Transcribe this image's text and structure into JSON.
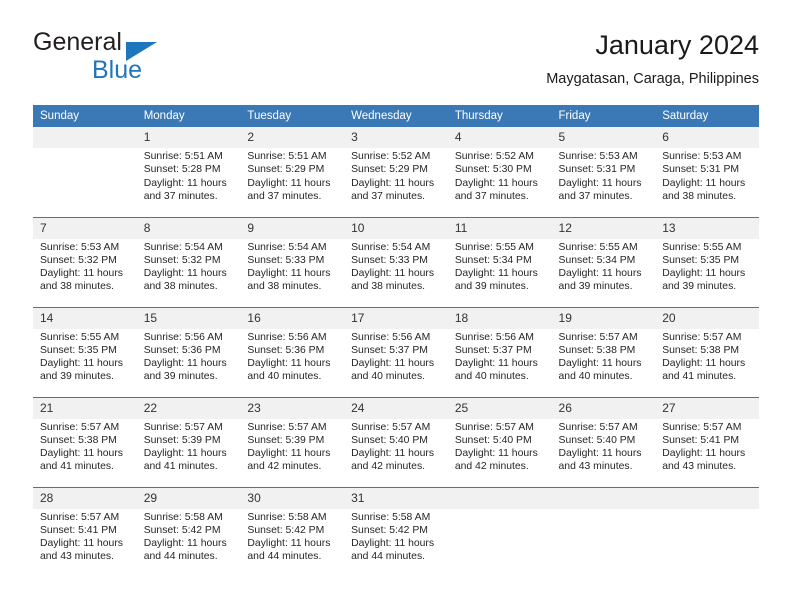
{
  "brand": {
    "word_one": "General",
    "word_two": "Blue",
    "triangle_color": "#1f76bc"
  },
  "header": {
    "title": "January 2024",
    "subtitle": "Maygatasan, Caraga, Philippines"
  },
  "theme": {
    "header_blue": "#3b78b6",
    "daynum_band": "#f1f1f1",
    "text": "#262626"
  },
  "weekday_headers": [
    "Sunday",
    "Monday",
    "Tuesday",
    "Wednesday",
    "Thursday",
    "Friday",
    "Saturday"
  ],
  "weeks": [
    [
      {
        "day": "",
        "empty": true,
        "sunrise": "",
        "sunset": "",
        "daylight": ""
      },
      {
        "day": "1",
        "sunrise": "Sunrise: 5:51 AM",
        "sunset": "Sunset: 5:28 PM",
        "daylight": "Daylight: 11 hours and 37 minutes."
      },
      {
        "day": "2",
        "sunrise": "Sunrise: 5:51 AM",
        "sunset": "Sunset: 5:29 PM",
        "daylight": "Daylight: 11 hours and 37 minutes."
      },
      {
        "day": "3",
        "sunrise": "Sunrise: 5:52 AM",
        "sunset": "Sunset: 5:29 PM",
        "daylight": "Daylight: 11 hours and 37 minutes."
      },
      {
        "day": "4",
        "sunrise": "Sunrise: 5:52 AM",
        "sunset": "Sunset: 5:30 PM",
        "daylight": "Daylight: 11 hours and 37 minutes."
      },
      {
        "day": "5",
        "sunrise": "Sunrise: 5:53 AM",
        "sunset": "Sunset: 5:31 PM",
        "daylight": "Daylight: 11 hours and 37 minutes."
      },
      {
        "day": "6",
        "sunrise": "Sunrise: 5:53 AM",
        "sunset": "Sunset: 5:31 PM",
        "daylight": "Daylight: 11 hours and 38 minutes."
      }
    ],
    [
      {
        "day": "7",
        "sunrise": "Sunrise: 5:53 AM",
        "sunset": "Sunset: 5:32 PM",
        "daylight": "Daylight: 11 hours and 38 minutes."
      },
      {
        "day": "8",
        "sunrise": "Sunrise: 5:54 AM",
        "sunset": "Sunset: 5:32 PM",
        "daylight": "Daylight: 11 hours and 38 minutes."
      },
      {
        "day": "9",
        "sunrise": "Sunrise: 5:54 AM",
        "sunset": "Sunset: 5:33 PM",
        "daylight": "Daylight: 11 hours and 38 minutes."
      },
      {
        "day": "10",
        "sunrise": "Sunrise: 5:54 AM",
        "sunset": "Sunset: 5:33 PM",
        "daylight": "Daylight: 11 hours and 38 minutes."
      },
      {
        "day": "11",
        "sunrise": "Sunrise: 5:55 AM",
        "sunset": "Sunset: 5:34 PM",
        "daylight": "Daylight: 11 hours and 39 minutes."
      },
      {
        "day": "12",
        "sunrise": "Sunrise: 5:55 AM",
        "sunset": "Sunset: 5:34 PM",
        "daylight": "Daylight: 11 hours and 39 minutes."
      },
      {
        "day": "13",
        "sunrise": "Sunrise: 5:55 AM",
        "sunset": "Sunset: 5:35 PM",
        "daylight": "Daylight: 11 hours and 39 minutes."
      }
    ],
    [
      {
        "day": "14",
        "sunrise": "Sunrise: 5:55 AM",
        "sunset": "Sunset: 5:35 PM",
        "daylight": "Daylight: 11 hours and 39 minutes."
      },
      {
        "day": "15",
        "sunrise": "Sunrise: 5:56 AM",
        "sunset": "Sunset: 5:36 PM",
        "daylight": "Daylight: 11 hours and 39 minutes."
      },
      {
        "day": "16",
        "sunrise": "Sunrise: 5:56 AM",
        "sunset": "Sunset: 5:36 PM",
        "daylight": "Daylight: 11 hours and 40 minutes."
      },
      {
        "day": "17",
        "sunrise": "Sunrise: 5:56 AM",
        "sunset": "Sunset: 5:37 PM",
        "daylight": "Daylight: 11 hours and 40 minutes."
      },
      {
        "day": "18",
        "sunrise": "Sunrise: 5:56 AM",
        "sunset": "Sunset: 5:37 PM",
        "daylight": "Daylight: 11 hours and 40 minutes."
      },
      {
        "day": "19",
        "sunrise": "Sunrise: 5:57 AM",
        "sunset": "Sunset: 5:38 PM",
        "daylight": "Daylight: 11 hours and 40 minutes."
      },
      {
        "day": "20",
        "sunrise": "Sunrise: 5:57 AM",
        "sunset": "Sunset: 5:38 PM",
        "daylight": "Daylight: 11 hours and 41 minutes."
      }
    ],
    [
      {
        "day": "21",
        "sunrise": "Sunrise: 5:57 AM",
        "sunset": "Sunset: 5:38 PM",
        "daylight": "Daylight: 11 hours and 41 minutes."
      },
      {
        "day": "22",
        "sunrise": "Sunrise: 5:57 AM",
        "sunset": "Sunset: 5:39 PM",
        "daylight": "Daylight: 11 hours and 41 minutes."
      },
      {
        "day": "23",
        "sunrise": "Sunrise: 5:57 AM",
        "sunset": "Sunset: 5:39 PM",
        "daylight": "Daylight: 11 hours and 42 minutes."
      },
      {
        "day": "24",
        "sunrise": "Sunrise: 5:57 AM",
        "sunset": "Sunset: 5:40 PM",
        "daylight": "Daylight: 11 hours and 42 minutes."
      },
      {
        "day": "25",
        "sunrise": "Sunrise: 5:57 AM",
        "sunset": "Sunset: 5:40 PM",
        "daylight": "Daylight: 11 hours and 42 minutes."
      },
      {
        "day": "26",
        "sunrise": "Sunrise: 5:57 AM",
        "sunset": "Sunset: 5:40 PM",
        "daylight": "Daylight: 11 hours and 43 minutes."
      },
      {
        "day": "27",
        "sunrise": "Sunrise: 5:57 AM",
        "sunset": "Sunset: 5:41 PM",
        "daylight": "Daylight: 11 hours and 43 minutes."
      }
    ],
    [
      {
        "day": "28",
        "sunrise": "Sunrise: 5:57 AM",
        "sunset": "Sunset: 5:41 PM",
        "daylight": "Daylight: 11 hours and 43 minutes."
      },
      {
        "day": "29",
        "sunrise": "Sunrise: 5:58 AM",
        "sunset": "Sunset: 5:42 PM",
        "daylight": "Daylight: 11 hours and 44 minutes."
      },
      {
        "day": "30",
        "sunrise": "Sunrise: 5:58 AM",
        "sunset": "Sunset: 5:42 PM",
        "daylight": "Daylight: 11 hours and 44 minutes."
      },
      {
        "day": "31",
        "sunrise": "Sunrise: 5:58 AM",
        "sunset": "Sunset: 5:42 PM",
        "daylight": "Daylight: 11 hours and 44 minutes."
      },
      {
        "day": "",
        "empty": true,
        "sunrise": "",
        "sunset": "",
        "daylight": ""
      },
      {
        "day": "",
        "empty": true,
        "sunrise": "",
        "sunset": "",
        "daylight": ""
      },
      {
        "day": "",
        "empty": true,
        "sunrise": "",
        "sunset": "",
        "daylight": ""
      }
    ]
  ]
}
